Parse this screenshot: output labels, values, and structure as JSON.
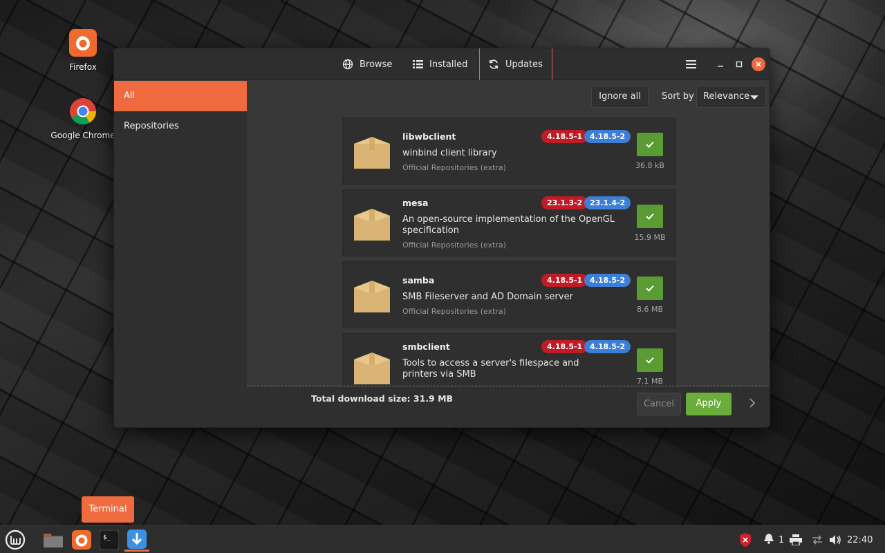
{
  "desktop": {
    "icons": [
      {
        "label": "Firefox",
        "icon": "firefox-icon"
      },
      {
        "label": "Google Chrome",
        "icon": "chrome-icon"
      }
    ]
  },
  "window": {
    "tabs": [
      {
        "label": "Browse",
        "icon": "globe-icon"
      },
      {
        "label": "Installed",
        "icon": "list-icon"
      },
      {
        "label": "Updates",
        "icon": "refresh-icon",
        "active": true
      }
    ],
    "sidebar": {
      "items": [
        {
          "label": "All",
          "active": true
        },
        {
          "label": "Repositories",
          "active": false
        }
      ]
    },
    "toolbar": {
      "ignore_all": "Ignore all",
      "sort_label": "Sort by",
      "sort_value": "Relevance"
    },
    "updates": [
      {
        "name": "libwbclient",
        "description": "winbind client library",
        "repo": "Official Repositories (extra)",
        "old_version": "4.18.5-1",
        "new_version": "4.18.5-2",
        "size": "36.8 kB",
        "checked": true
      },
      {
        "name": "mesa",
        "description": "An open-source implementation of the OpenGL specification",
        "repo": "Official Repositories (extra)",
        "old_version": "23.1.3-2",
        "new_version": "23.1.4-2",
        "size": "15.9 MB",
        "checked": true
      },
      {
        "name": "samba",
        "description": "SMB Fileserver and AD Domain server",
        "repo": "Official Repositories (extra)",
        "old_version": "4.18.5-1",
        "new_version": "4.18.5-2",
        "size": "8.6 MB",
        "checked": true
      },
      {
        "name": "smbclient",
        "description": "Tools to access a server's filespace and printers via SMB",
        "repo": "",
        "old_version": "4.18.5-1",
        "new_version": "4.18.5-2",
        "size": "7.1 MB",
        "checked": true
      }
    ],
    "footer": {
      "total": "Total download size: 31.9 MB",
      "cancel": "Cancel",
      "apply": "Apply"
    }
  },
  "tooltip": "Terminal",
  "taskbar": {
    "tray": {
      "notifications_count": "1",
      "clock": "22:40"
    }
  },
  "colors": {
    "accent": "#ef6b3f",
    "old_version": "#c01c28",
    "new_version": "#3d7fd6",
    "check": "#5a9b33",
    "apply": "#6aad3a"
  }
}
